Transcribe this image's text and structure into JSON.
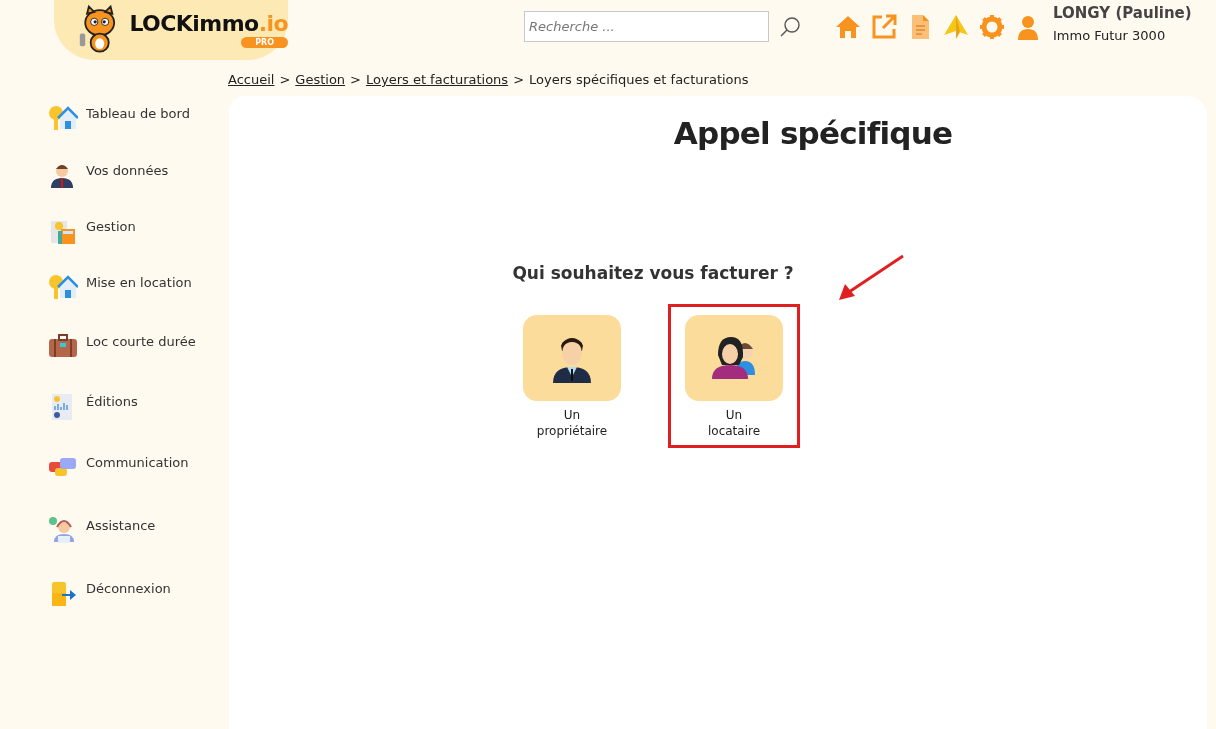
{
  "logo": {
    "name": "LOCKimmo",
    "suffix": ".io",
    "badge": "PRO"
  },
  "search": {
    "placeholder": "Recherche ..."
  },
  "toolbar": [
    {
      "kind": "home"
    },
    {
      "kind": "external"
    },
    {
      "kind": "document"
    },
    {
      "kind": "plane"
    },
    {
      "kind": "settings"
    },
    {
      "kind": "user"
    }
  ],
  "user": {
    "name": "LONGY (Pauline)",
    "company": "Immo Futur 3000"
  },
  "breadcrumb": {
    "separators": [
      ">",
      ">",
      ">"
    ],
    "items": [
      {
        "label": "Accueil",
        "link": true
      },
      {
        "label": "Gestion",
        "link": true
      },
      {
        "label": "Loyers et facturations",
        "link": true
      },
      {
        "label": "Loyers spécifiques et facturations",
        "link": false
      }
    ]
  },
  "sidebar": {
    "items": [
      {
        "label": "Tableau de bord",
        "kind": "keyhouse"
      },
      {
        "label": "Vos données",
        "kind": "person"
      },
      {
        "label": "Gestion",
        "kind": "calculator"
      },
      {
        "label": "Mise en location",
        "kind": "keyhouse"
      },
      {
        "label": "Loc courte durée",
        "kind": "suitcase"
      },
      {
        "label": "Éditions",
        "kind": "report"
      },
      {
        "label": "Communication",
        "kind": "chat"
      },
      {
        "label": "Assistance",
        "kind": "support"
      },
      {
        "label": "Déconnexion",
        "kind": "exit"
      }
    ]
  },
  "page": {
    "title": "Appel spécifique",
    "question": "Qui souhaitez vous facturer ?",
    "options": [
      {
        "kind": "owner",
        "label_1": "Un",
        "label_2": "propriétaire",
        "highlighted": false
      },
      {
        "kind": "tenant",
        "label_1": "Un",
        "label_2": "locataire",
        "highlighted": true
      }
    ]
  }
}
